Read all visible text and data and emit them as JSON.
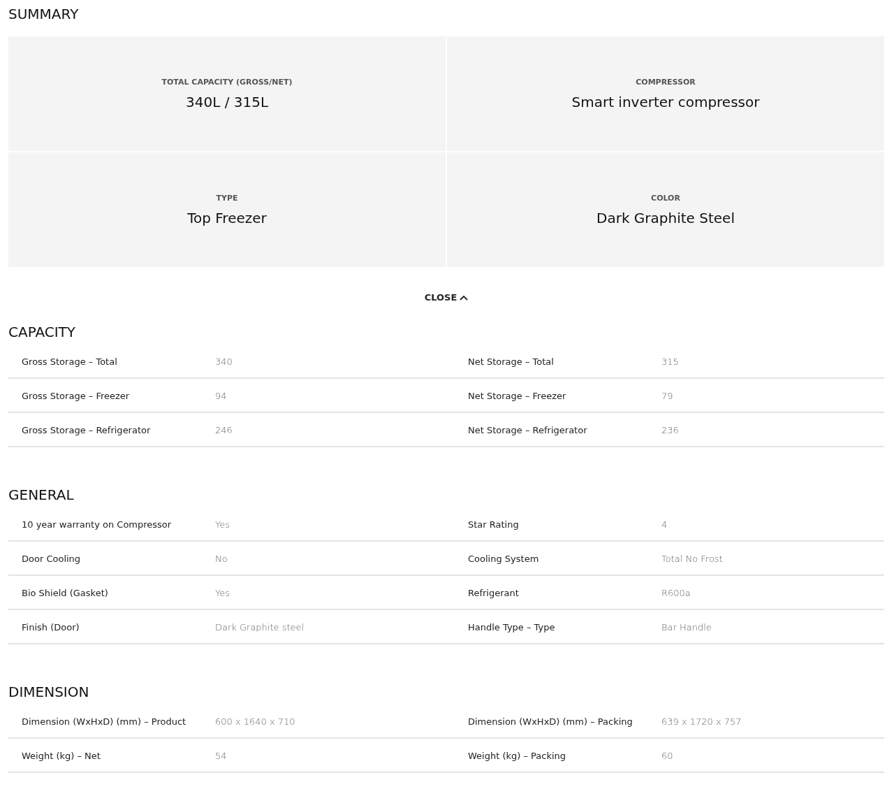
{
  "summary": {
    "title": "SUMMARY",
    "items": [
      {
        "label": "TOTAL CAPACITY (GROSS/NET)",
        "value": "340L / 315L"
      },
      {
        "label": "COMPRESSOR",
        "value": "Smart inverter compressor"
      },
      {
        "label": "TYPE",
        "value": "Top Freezer"
      },
      {
        "label": "COLOR",
        "value": "Dark Graphite Steel"
      }
    ]
  },
  "close_button": {
    "label": "CLOSE"
  },
  "sections": [
    {
      "title": "CAPACITY",
      "rows": [
        [
          {
            "label": "Gross Storage – Total",
            "value": "340"
          },
          {
            "label": "Net Storage – Total",
            "value": "315"
          }
        ],
        [
          {
            "label": "Gross Storage – Freezer",
            "value": "94"
          },
          {
            "label": "Net Storage – Freezer",
            "value": "79"
          }
        ],
        [
          {
            "label": "Gross Storage – Refrigerator",
            "value": "246"
          },
          {
            "label": "Net Storage – Refrigerator",
            "value": "236"
          }
        ]
      ]
    },
    {
      "title": "GENERAL",
      "rows": [
        [
          {
            "label": "10 year warranty on Compressor",
            "value": "Yes"
          },
          {
            "label": "Star Rating",
            "value": "4"
          }
        ],
        [
          {
            "label": "Door Cooling",
            "value": "No"
          },
          {
            "label": "Cooling System",
            "value": "Total No Frost"
          }
        ],
        [
          {
            "label": "Bio Shield (Gasket)",
            "value": "Yes"
          },
          {
            "label": "Refrigerant",
            "value": "R600a"
          }
        ],
        [
          {
            "label": "Finish (Door)",
            "value": "Dark Graphite steel"
          },
          {
            "label": "Handle Type – Type",
            "value": "Bar Handle"
          }
        ]
      ]
    },
    {
      "title": "DIMENSION",
      "rows": [
        [
          {
            "label": "Dimension (WxHxD) (mm) – Product",
            "value": "600 x 1640 x 710"
          },
          {
            "label": "Dimension (WxHxD) (mm) – Packing",
            "value": "639 x 1720 x 757"
          }
        ],
        [
          {
            "label": "Weight (kg) – Net",
            "value": "54"
          },
          {
            "label": "Weight (kg) – Packing",
            "value": "60"
          }
        ]
      ]
    }
  ]
}
